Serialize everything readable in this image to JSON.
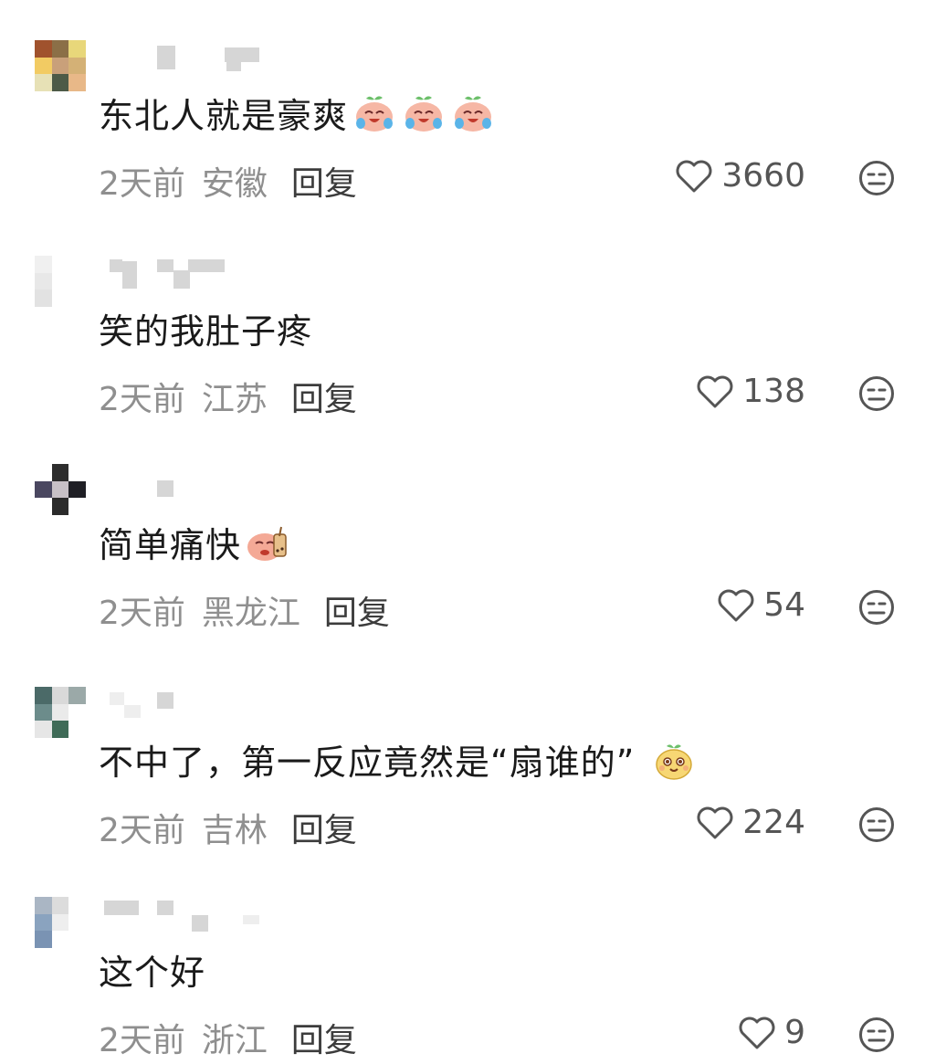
{
  "comments": [
    {
      "text": "东北人就是豪爽",
      "emoji_names": [
        "crying-laughing-peach-emoji",
        "crying-laughing-peach-emoji",
        "crying-laughing-peach-emoji"
      ],
      "time": "2天前",
      "location": "安徽",
      "reply_label": "回复",
      "likes": "3660",
      "avatar_colors": [
        "#a0522d",
        "#8b6f47",
        "#e8d77a",
        "#f2cb63",
        "#c9a07a",
        "#d4b176",
        "#e7e1b6",
        "#4d5a47",
        "#e8b888"
      ]
    },
    {
      "text": "笑的我肚子疼",
      "emoji_names": [],
      "time": "2天前",
      "location": "江苏",
      "reply_label": "回复",
      "likes": "138",
      "avatar_colors": [
        "#f0f0f0",
        "#ffffff",
        "#ffffff",
        "#e8e8e8",
        "#ffffff",
        "#ffffff",
        "#e2e2e2",
        "#ffffff",
        "#ffffff"
      ]
    },
    {
      "text": "简单痛快",
      "emoji_names": [
        "peach-bubble-tea-emoji"
      ],
      "time": "2天前",
      "location": "黑龙江",
      "reply_label": "回复",
      "likes": "54",
      "avatar_colors": [
        "#ffffff",
        "#2d2d2d",
        "#ffffff",
        "#4a4760",
        "#c7c0c6",
        "#1f1f25",
        "#ffffff",
        "#2b2b2b",
        "#ffffff"
      ]
    },
    {
      "text": "不中了，第一反应竟然是“扇谁的”",
      "emoji_names": [
        "yellow-smiling-pear-emoji"
      ],
      "time": "2天前",
      "location": "吉林",
      "reply_label": "回复",
      "likes": "224",
      "avatar_colors": [
        "#4b6a68",
        "#d9d9d9",
        "#9ba9a8",
        "#6c8c8b",
        "#eaeaea",
        "#ffffff",
        "#e6e6e6",
        "#3f6b57",
        "#ffffff"
      ]
    },
    {
      "text": "这个好",
      "emoji_names": [],
      "time": "2天前",
      "location": "浙江",
      "reply_label": "回复",
      "likes": "9",
      "avatar_colors": [
        "#aab6c4",
        "#dcdcdc",
        "#ffffff",
        "#8aa3bf",
        "#eeeeee",
        "#ffffff",
        "#7a93b3",
        "#ffffff",
        "#ffffff"
      ]
    }
  ],
  "icons": {
    "like": "heart-outline-icon",
    "dislike": "neutral-face-icon"
  }
}
